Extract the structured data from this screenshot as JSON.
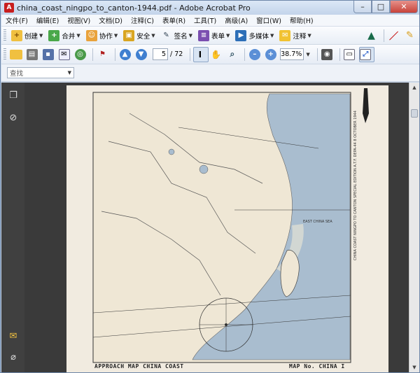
{
  "window": {
    "title": "china_coast_ningpo_to_canton-1944.pdf - Adobe Acrobat Pro",
    "controls": {
      "minimize": "–",
      "maximize": "□",
      "close": "✕"
    }
  },
  "menu": [
    "文件(F)",
    "编辑(E)",
    "视图(V)",
    "文档(D)",
    "注释(C)",
    "表单(R)",
    "工具(T)",
    "高级(A)",
    "窗口(W)",
    "帮助(H)"
  ],
  "toolbar": {
    "create": "创建",
    "combine": "合并",
    "collaborate": "协作",
    "secure": "安全",
    "sign": "签名",
    "forms": "表单",
    "multimedia": "多媒体",
    "comment": "注释"
  },
  "nav": {
    "current_page": "5",
    "total_pages": "/ 72",
    "zoom": "38.7%"
  },
  "find": {
    "placeholder": "查找"
  },
  "map": {
    "bottom_left": "APPROACH MAP CHINA COAST",
    "bottom_right": "MAP No. CHINA I",
    "side_text": "CHINA COAST NINGPO TO CANTON  SPECIAL EDITION A.T.F. DEPA-44  8 OCTOBER 1944",
    "sea_label": "EAST CHINA SEA"
  },
  "colors": {
    "sea": "#a9bdcf",
    "land": "#efe7d5",
    "accent_red": "#c81e1e"
  }
}
